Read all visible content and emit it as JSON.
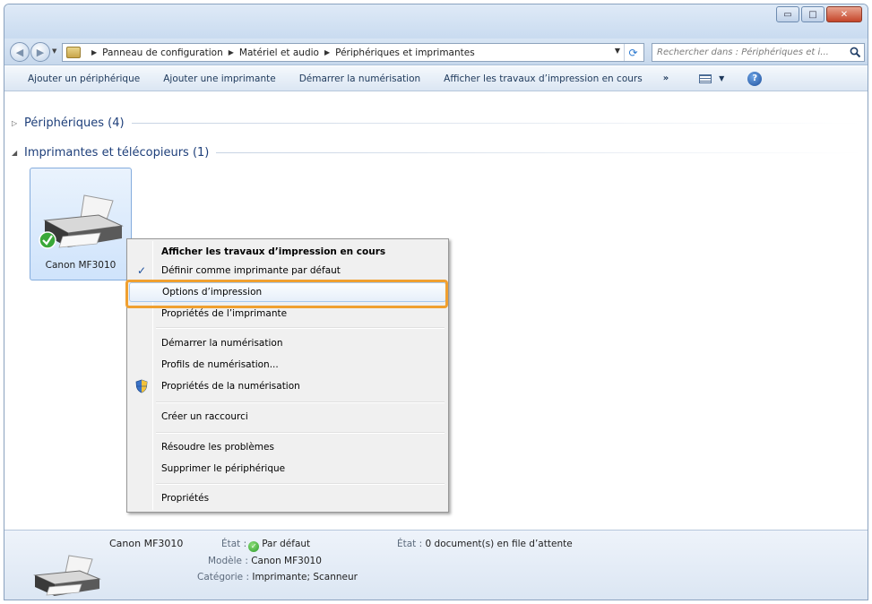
{
  "window": {
    "controls": {
      "minimize": "▭",
      "maximize": "□",
      "close": "✕"
    }
  },
  "address": {
    "breadcrumbs": [
      "Panneau de configuration",
      "Matériel et audio",
      "Périphériques et imprimantes"
    ],
    "search_placeholder": "Rechercher dans : Périphériques et i..."
  },
  "toolbar": {
    "items": [
      "Ajouter un périphérique",
      "Ajouter une imprimante",
      "Démarrer la numérisation",
      "Afficher les travaux d’impression en cours"
    ],
    "more": "»",
    "help": "?"
  },
  "groups": {
    "devices": "Périphériques (4)",
    "printers": "Imprimantes et télécopieurs (1)"
  },
  "device": {
    "name": "Canon MF3010"
  },
  "context_menu": {
    "items": [
      "Afficher les travaux d’impression en cours",
      "Définir comme imprimante par défaut",
      "Options d’impression",
      "Propriétés de l’imprimante",
      "Démarrer la numérisation",
      "Profils de numérisation...",
      "Propriétés de la numérisation",
      "Créer un raccourci",
      "Résoudre les problèmes",
      "Supprimer le périphérique",
      "Propriétés"
    ],
    "check": "✓"
  },
  "details": {
    "name": "Canon MF3010",
    "state_label": "État :",
    "state_value": "Par défaut",
    "queue_label": "État :",
    "queue_value": "0 document(s) en file d’attente",
    "model_label": "Modèle :",
    "model_value": "Canon MF3010",
    "category_label": "Catégorie :",
    "category_value": "Imprimante; Scanneur"
  },
  "colors": {
    "highlight_ring": "#f0a030",
    "group_header": "#1e3f7a",
    "selection": "#cfe3fb"
  }
}
